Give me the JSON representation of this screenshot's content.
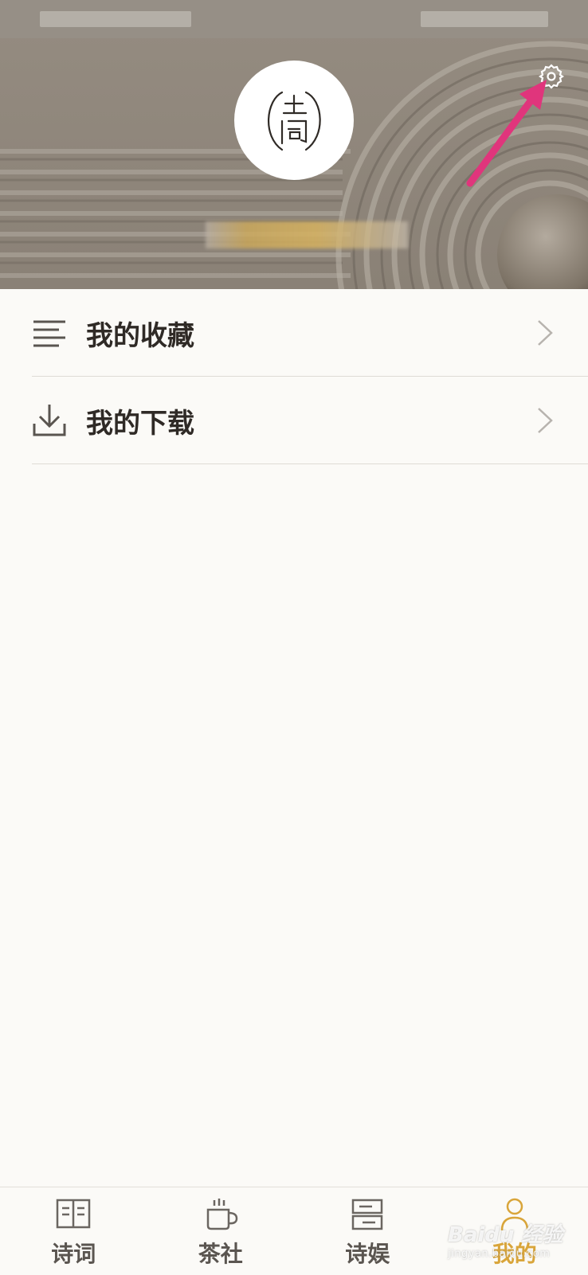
{
  "menu": {
    "items": [
      {
        "label": "我的收藏",
        "icon": "list-icon"
      },
      {
        "label": "我的下载",
        "icon": "download-icon"
      }
    ]
  },
  "tabbar": {
    "tabs": [
      {
        "label": "诗词",
        "icon": "book-icon",
        "active": false
      },
      {
        "label": "茶社",
        "icon": "teacup-icon",
        "active": false
      },
      {
        "label": "诗娱",
        "icon": "game-icon",
        "active": false
      },
      {
        "label": "我的",
        "icon": "profile-icon",
        "active": true
      }
    ]
  },
  "header": {
    "avatar_icon": "poetry-logo-icon",
    "settings_icon": "gear-icon"
  },
  "watermark": {
    "brand": "Baidu 经验",
    "url": "jingyan.baidu.com"
  },
  "colors": {
    "accent": "#d9a53a",
    "annotation_arrow": "#e0357c",
    "header_bg": "#8f877d"
  }
}
